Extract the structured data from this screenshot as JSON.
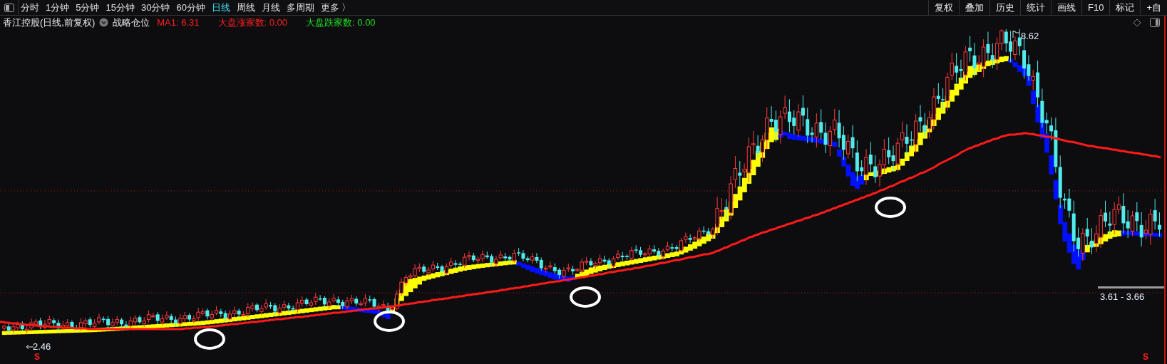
{
  "toolbar": {
    "periods": [
      {
        "label": "分时",
        "selected": false
      },
      {
        "label": "1分钟",
        "selected": false
      },
      {
        "label": "5分钟",
        "selected": false
      },
      {
        "label": "15分钟",
        "selected": false
      },
      {
        "label": "30分钟",
        "selected": false
      },
      {
        "label": "60分钟",
        "selected": false
      },
      {
        "label": "日线",
        "selected": true
      },
      {
        "label": "周线",
        "selected": false
      },
      {
        "label": "月线",
        "selected": false
      },
      {
        "label": "多周期",
        "selected": false
      },
      {
        "label": "更多 〉",
        "selected": false
      }
    ],
    "tools": [
      "复权",
      "叠加",
      "历史",
      "统计",
      "画线",
      "F10",
      "标记",
      "+自"
    ]
  },
  "legend": {
    "title": "香江控股(日线,前复权)",
    "indicator": "战略仓位",
    "values": [
      {
        "text": "MA1: 6.31",
        "color": "#ff2020"
      },
      {
        "text": "大盘涨家数: 0.00",
        "color": "#ff2020"
      },
      {
        "text": "大盘跌家数: 0.00",
        "color": "#20e020"
      }
    ]
  },
  "chart": {
    "high_label": "8.62",
    "low_label": "2.46",
    "range_label": "3.61 - 3.66",
    "signals": [
      "S",
      "S"
    ]
  }
}
